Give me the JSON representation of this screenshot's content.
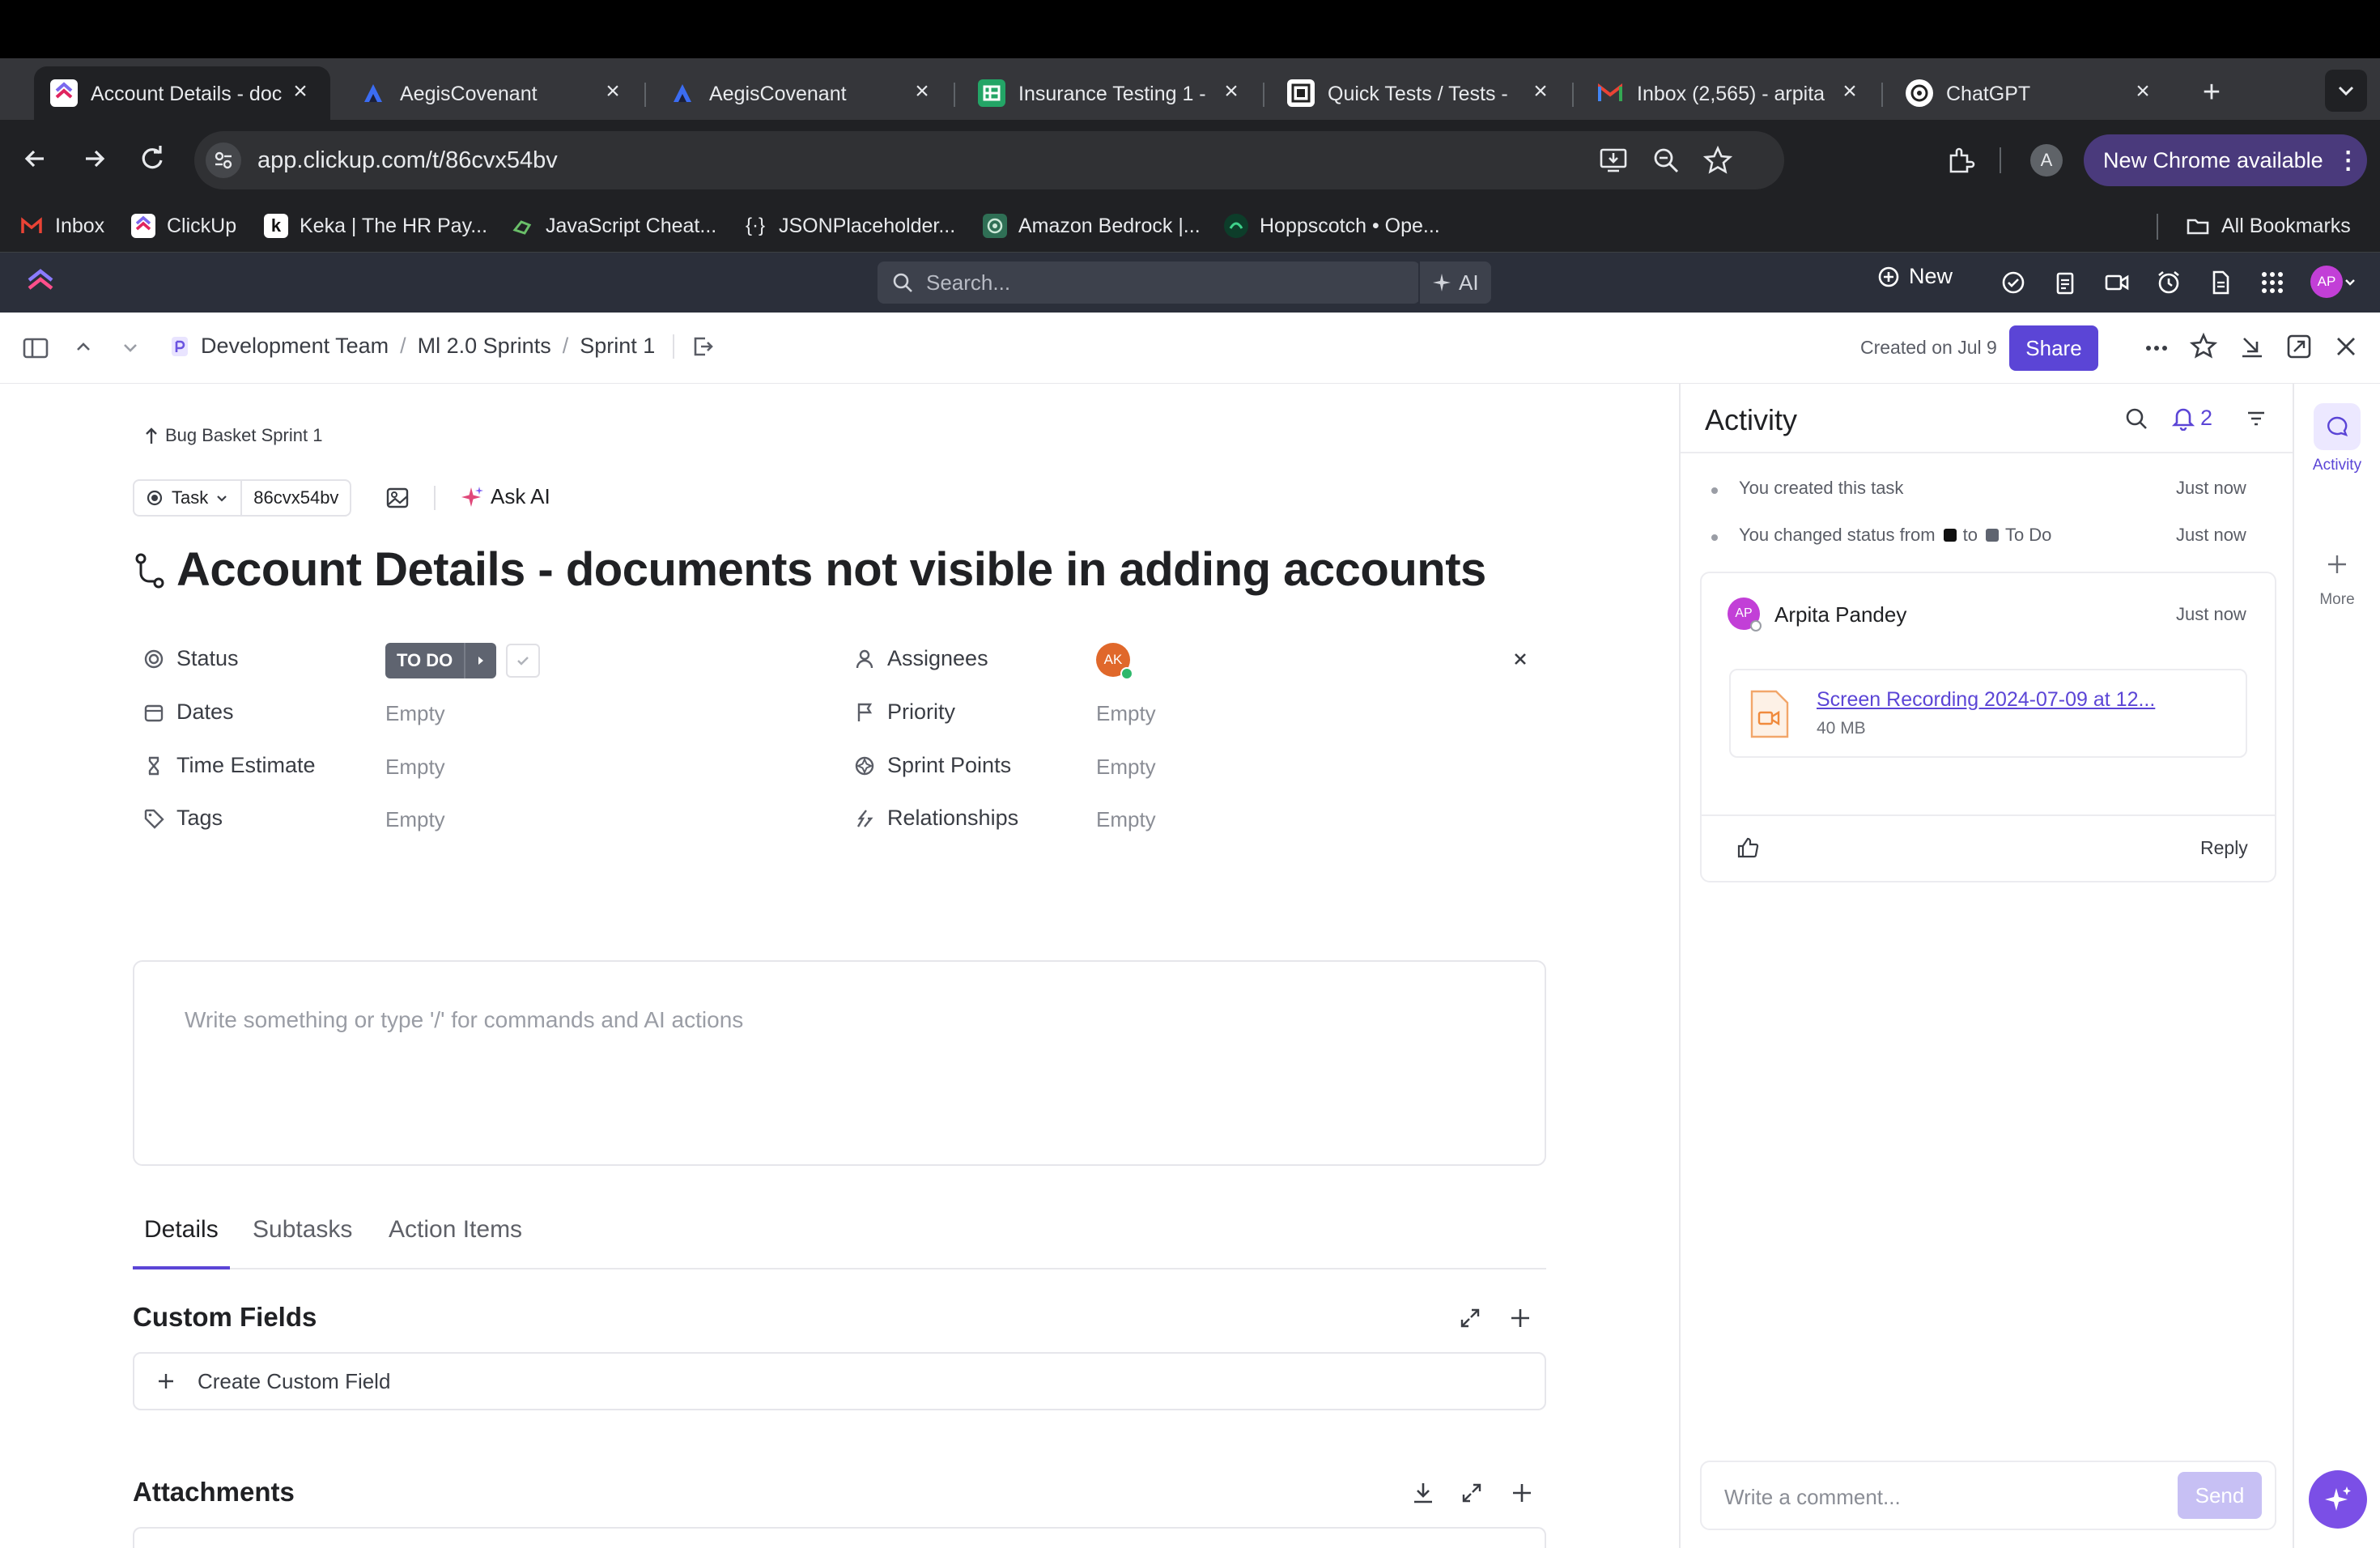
{
  "browser": {
    "tabs": [
      {
        "title": "Account Details - doc",
        "active": true,
        "favicon": "clickup-icon"
      },
      {
        "title": "AegisCovenant",
        "favicon": "aegis-icon"
      },
      {
        "title": "AegisCovenant",
        "favicon": "aegis-icon"
      },
      {
        "title": "Insurance Testing 1 -",
        "favicon": "sheets-icon"
      },
      {
        "title": "Quick Tests / Tests -",
        "favicon": "tests-icon"
      },
      {
        "title": "Inbox (2,565) - arpita",
        "favicon": "gmail-icon"
      },
      {
        "title": "ChatGPT",
        "favicon": "chatgpt-icon"
      }
    ],
    "url": "app.clickup.com/t/86cvx54bv",
    "profile_initial": "A",
    "update_label": "New Chrome available",
    "bookmarks": [
      "Inbox",
      "ClickUp",
      "Keka | The HR Pay...",
      "JavaScript Cheat...",
      "JSONPlaceholder...",
      "Amazon Bedrock |...",
      "Hoppscotch • Ope..."
    ],
    "all_bookmarks": "All Bookmarks"
  },
  "app_header": {
    "search_placeholder": "Search...",
    "ai_label": "AI",
    "new_label": "New",
    "avatar_initials": "AP"
  },
  "task_toolbar": {
    "breadcrumb": [
      "Development Team",
      "Ml 2.0 Sprints",
      "Sprint 1"
    ],
    "created": "Created on Jul 9",
    "share_label": "Share"
  },
  "task": {
    "parent": "Bug Basket Sprint 1",
    "type": "Task",
    "id": "86cvx54bv",
    "ask_ai": "Ask AI",
    "title": "Account Details - documents not visible in adding accounts",
    "status_label": "Status",
    "status_value": "TO DO",
    "dates_label": "Dates",
    "dates_value": "Empty",
    "time_estimate_label": "Time Estimate",
    "time_estimate_value": "Empty",
    "tags_label": "Tags",
    "tags_value": "Empty",
    "assignees_label": "Assignees",
    "assignee_initials": "AK",
    "priority_label": "Priority",
    "priority_value": "Empty",
    "sprint_points_label": "Sprint Points",
    "sprint_points_value": "Empty",
    "relationships_label": "Relationships",
    "relationships_value": "Empty",
    "description_placeholder": "Write something or type '/' for commands and AI actions",
    "tabs": [
      "Details",
      "Subtasks",
      "Action Items"
    ],
    "custom_fields_heading": "Custom Fields",
    "create_custom_field": "Create Custom Field",
    "attachments_heading": "Attachments"
  },
  "activity": {
    "title": "Activity",
    "notification_count": "2",
    "events": [
      {
        "text": "You created this task",
        "time": "Just now"
      },
      {
        "text_prefix": "You changed status from",
        "text_mid": "to",
        "text_to": "To Do",
        "time": "Just now"
      }
    ],
    "comment": {
      "author": "Arpita Pandey",
      "initials": "AP",
      "time": "Just now",
      "file_name": "Screen Recording 2024-07-09 at 12...",
      "file_size": "40 MB",
      "reply": "Reply"
    },
    "comment_placeholder": "Write a comment...",
    "send_label": "Send"
  },
  "rail": {
    "activity_label": "Activity",
    "more_label": "More"
  },
  "colors": {
    "accent": "#5b45d6",
    "status_gray": "#5f6470",
    "assignee_orange": "#e0682b",
    "ap_magenta": "#c23fd7"
  }
}
